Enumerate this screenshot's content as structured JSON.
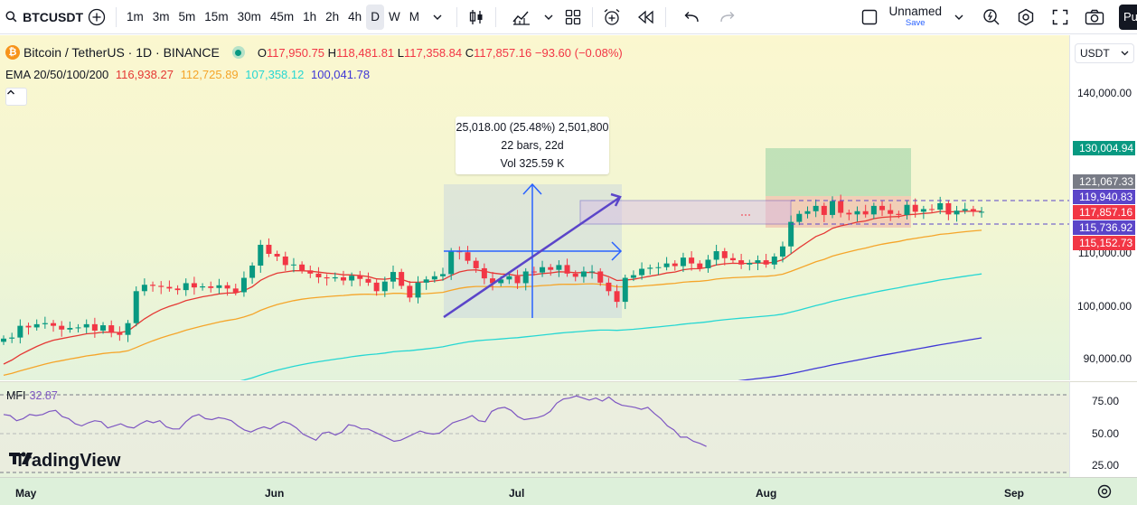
{
  "toolbar": {
    "symbol": "BTCUSDT",
    "intervals": [
      "1m",
      "3m",
      "5m",
      "15m",
      "30m",
      "45m",
      "1h",
      "2h",
      "4h",
      "D",
      "W",
      "M"
    ],
    "active_interval": "D",
    "layout_name": "Unnamed",
    "save_label": "Save",
    "publish_label": "Pu"
  },
  "legend": {
    "title": "Bitcoin / TetherUS · 1D · BINANCE",
    "open_label": "O",
    "open": "117,950.75",
    "high_label": "H",
    "high": "118,481.81",
    "low_label": "L",
    "low": "117,358.84",
    "close_label": "C",
    "close": "117,857.16",
    "change": "−93.60 (−0.08%)",
    "ema_label": "EMA 20/50/100/200",
    "ema_values": [
      "116,938.27",
      "112,725.89",
      "107,358.12",
      "100,041.78"
    ]
  },
  "colors": {
    "up": "#089981",
    "down": "#f23645",
    "ema20": "#e53935",
    "ema50": "#f5a52a",
    "ema100": "#26d7d3",
    "ema200": "#3f37d6",
    "accent": "#2962ff",
    "mfi": "#7e57c2"
  },
  "measure_box": {
    "line1": "25,018.00 (25.48%) 2,501,800",
    "line2": "22 bars, 22d",
    "line3": "Vol 325.59 K"
  },
  "price_scale": {
    "currency": "USDT",
    "ticks": [
      "140,000.00",
      "110,000.00",
      "100,000.00",
      "90,000.00"
    ],
    "labels": [
      {
        "text": "130,004.94",
        "color": "#089981"
      },
      {
        "text": "121,067.33",
        "color": "#787b86"
      },
      {
        "text": "119,940.83",
        "color": "#5b45c9"
      },
      {
        "text": "117,857.16",
        "color": "#f23645"
      },
      {
        "text": "115,736.92",
        "color": "#5b45c9"
      },
      {
        "text": "115,152.73",
        "color": "#f23645"
      }
    ]
  },
  "mfi": {
    "label": "MFI",
    "value": "32.87",
    "ticks": [
      "75.00",
      "50.00",
      "25.00"
    ]
  },
  "time_axis": [
    "May",
    "Jun",
    "Jul",
    "Aug",
    "Sep"
  ],
  "branding": "TradingView"
}
